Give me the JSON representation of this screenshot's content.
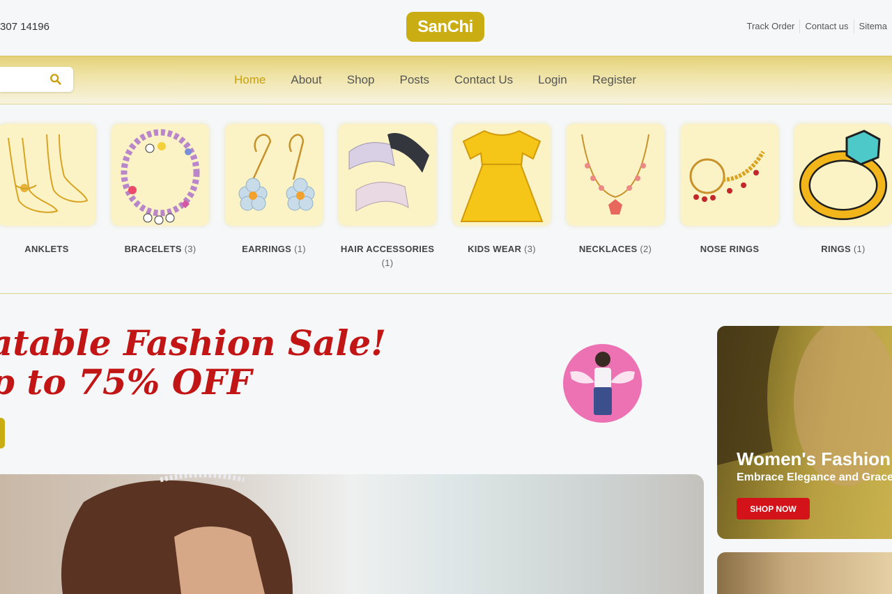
{
  "header": {
    "phone": "307 14196",
    "logo": "SanChi",
    "links": [
      "Track Order",
      "Contact us",
      "Sitema"
    ]
  },
  "nav": {
    "items": [
      {
        "label": "Home",
        "active": true
      },
      {
        "label": "About"
      },
      {
        "label": "Shop"
      },
      {
        "label": "Posts"
      },
      {
        "label": "Contact Us"
      },
      {
        "label": "Login"
      },
      {
        "label": "Register"
      }
    ],
    "search_icon": "search-icon",
    "accent": "#c9ad12"
  },
  "categories": [
    {
      "name": "ANKLETS",
      "count": ""
    },
    {
      "name": "BRACELETS",
      "count": "(3)"
    },
    {
      "name": "EARRINGS",
      "count": "(1)"
    },
    {
      "name": "HAIR ACCESSORIES",
      "count": "(1)"
    },
    {
      "name": "KIDS WEAR",
      "count": "(3)"
    },
    {
      "name": "NECKLACES",
      "count": "(2)"
    },
    {
      "name": "NOSE RINGS",
      "count": ""
    },
    {
      "name": "RINGS",
      "count": "(1)"
    }
  ],
  "hero": {
    "line1": "atable Fashion Sale!",
    "line2": "p to 75% OFF",
    "color": "#c21515"
  },
  "promo": {
    "title": "Women's Fashion",
    "subtitle": "Embrace Elegance and Grace",
    "button": "SHOP NOW",
    "button_color": "#d4121a"
  }
}
